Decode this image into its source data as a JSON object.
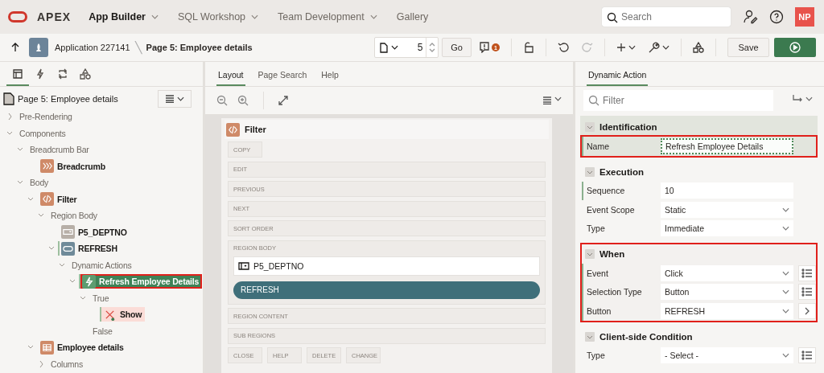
{
  "header": {
    "logo": "APEX",
    "nav": [
      {
        "label": "App Builder",
        "selected": true,
        "has_menu": true
      },
      {
        "label": "SQL Workshop",
        "selected": false,
        "has_menu": true
      },
      {
        "label": "Team Development",
        "selected": false,
        "has_menu": true
      },
      {
        "label": "Gallery",
        "selected": false,
        "has_menu": false
      }
    ],
    "search": {
      "placeholder": "Search"
    },
    "avatar": "NP"
  },
  "toolbar": {
    "breadcrumb": [
      "Application 227141",
      "Page 5: Employee details"
    ],
    "separator": "╲",
    "page_number": "5",
    "go": "Go",
    "warnings": "1",
    "save": "Save"
  },
  "left_panel": {
    "tabs": [
      {
        "kind": "rendering",
        "selected": true
      },
      {
        "kind": "dynamic-actions",
        "selected": false
      },
      {
        "kind": "processing",
        "selected": false
      },
      {
        "kind": "shared-components",
        "selected": false
      }
    ],
    "title": "Page 5: Employee details",
    "tree": [
      {
        "label": "Pre-Rendering",
        "expanded": false
      },
      {
        "label": "Components",
        "expanded": true,
        "children": [
          {
            "label": "Breadcrumb Bar",
            "expanded": true,
            "children": [
              {
                "label": "Breadcrumb",
                "kind": "breadcrumb"
              }
            ]
          },
          {
            "label": "Body",
            "expanded": true,
            "children": [
              {
                "label": "Filter",
                "kind": "region",
                "expanded": true,
                "children": [
                  {
                    "label": "Region Body",
                    "expanded": true,
                    "children": [
                      {
                        "label": "P5_DEPTNO",
                        "kind": "item"
                      },
                      {
                        "label": "REFRESH",
                        "kind": "button",
                        "bold": true,
                        "marked": true,
                        "expanded": true,
                        "children": [
                          {
                            "label": "Dynamic Actions",
                            "expanded": true,
                            "children": [
                              {
                                "label": "Refresh Employee Details",
                                "kind": "dynamic-action",
                                "selected": true,
                                "marked": true,
                                "highlighted": true,
                                "expanded": true,
                                "children": [
                                  {
                                    "label": "True",
                                    "expanded": true,
                                    "children": [
                                      {
                                        "label": "Show",
                                        "kind": "action",
                                        "marked": true
                                      }
                                    ]
                                  },
                                  {
                                    "label": "False"
                                  }
                                ]
                              }
                            ]
                          }
                        ]
                      }
                    ]
                  }
                ]
              },
              {
                "label": "Employee details",
                "kind": "report",
                "expanded": true,
                "children": [
                  {
                    "label": "Columns",
                    "expanded": false
                  }
                ]
              }
            ]
          }
        ]
      }
    ]
  },
  "center": {
    "tabs": [
      {
        "label": "Layout",
        "selected": true
      },
      {
        "label": "Page Search",
        "selected": false
      },
      {
        "label": "Help",
        "selected": false
      }
    ],
    "region": {
      "title": "Filter",
      "slots": [
        {
          "kind": "small",
          "label": "COPY"
        },
        {
          "kind": "wide",
          "label": "EDIT"
        },
        {
          "kind": "wide",
          "label": "PREVIOUS"
        },
        {
          "kind": "wide",
          "label": "NEXT"
        },
        {
          "kind": "wide",
          "label": "SORT ORDER"
        },
        {
          "kind": "body",
          "label": "REGION BODY",
          "items": [
            {
              "kind": "item",
              "label": "P5_DEPTNO"
            },
            {
              "kind": "button",
              "label": "REFRESH"
            }
          ]
        },
        {
          "kind": "wide",
          "label": "REGION CONTENT"
        },
        {
          "kind": "wide",
          "label": "SUB REGIONS"
        },
        {
          "kind": "small",
          "label": "CLOSE"
        },
        {
          "kind": "small",
          "label": "HELP"
        },
        {
          "kind": "small",
          "label": "DELETE"
        },
        {
          "kind": "small",
          "label": "CHANGE"
        }
      ]
    }
  },
  "right_panel": {
    "tabs": [
      {
        "label": "Dynamic Action",
        "selected": true
      }
    ],
    "filter": {
      "placeholder": "Filter"
    },
    "sections": [
      {
        "title": "Identification",
        "expanded": true,
        "active": true,
        "highlighted": false,
        "properties": [
          {
            "label": "Name",
            "kind": "text",
            "value": "Refresh Employee Details",
            "required": true,
            "focused": true,
            "highlighted": true
          }
        ]
      },
      {
        "title": "Execution",
        "expanded": true,
        "active": false,
        "highlighted": false,
        "properties": [
          {
            "label": "Sequence",
            "kind": "text",
            "value": "10",
            "required": true,
            "focused": false,
            "highlighted": false
          },
          {
            "label": "Event Scope",
            "kind": "select",
            "value": "Static",
            "required": false,
            "highlighted": false
          },
          {
            "label": "Type",
            "kind": "select",
            "value": "Immediate",
            "required": false,
            "highlighted": false
          }
        ]
      },
      {
        "title": "When",
        "expanded": true,
        "active": false,
        "highlighted": true,
        "properties": [
          {
            "label": "Event",
            "kind": "select",
            "value": "Click",
            "required": true,
            "highlighted": false,
            "button": {
              "kind": "list"
            }
          },
          {
            "label": "Selection Type",
            "kind": "select",
            "value": "Button",
            "required": true,
            "highlighted": false,
            "button": {
              "kind": "list"
            }
          },
          {
            "label": "Button",
            "kind": "select",
            "value": "REFRESH",
            "required": true,
            "highlighted": false,
            "button": {
              "kind": "next"
            }
          }
        ]
      },
      {
        "title": "Client-side Condition",
        "expanded": true,
        "active": false,
        "highlighted": false,
        "properties": [
          {
            "label": "Type",
            "kind": "select",
            "value": "- Select -",
            "required": false,
            "highlighted": false,
            "button": {
              "kind": "list"
            }
          }
        ]
      }
    ]
  }
}
